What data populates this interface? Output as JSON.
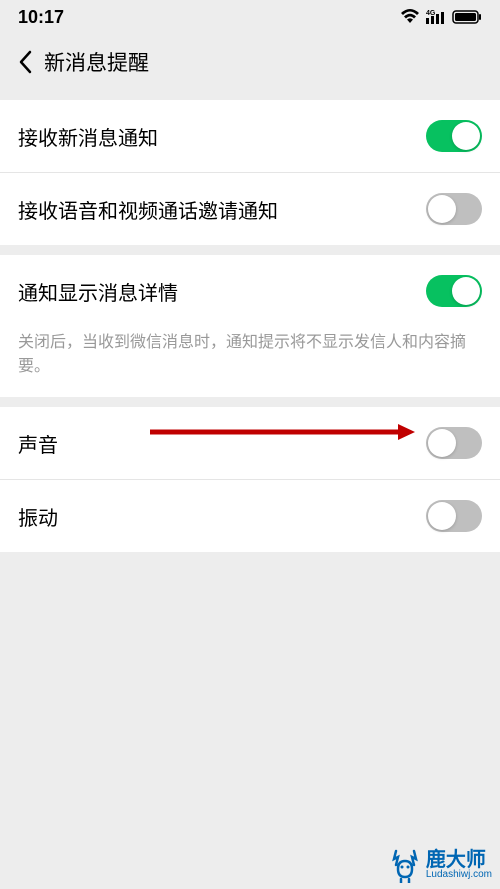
{
  "status_bar": {
    "time": "10:17",
    "signal_label": "4G"
  },
  "header": {
    "title": "新消息提醒"
  },
  "section1": {
    "receive_new_msg": {
      "label": "接收新消息通知",
      "on": true
    },
    "receive_voice_video": {
      "label": "接收语音和视频通话邀请通知",
      "on": false
    }
  },
  "section2": {
    "show_detail": {
      "label": "通知显示消息详情",
      "on": true,
      "description": "关闭后，当收到微信消息时，通知提示将不显示发信人和内容摘要。"
    }
  },
  "section3": {
    "sound": {
      "label": "声音",
      "on": false
    },
    "vibrate": {
      "label": "振动",
      "on": false
    }
  },
  "watermark": {
    "brand": "鹿大师",
    "url": "Ludashiwj.com"
  },
  "colors": {
    "toggle_on": "#07c160",
    "toggle_off": "#bfbfbf",
    "arrow": "#c00000",
    "brand_blue": "#0066b3"
  }
}
